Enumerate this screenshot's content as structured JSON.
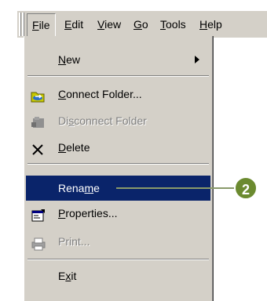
{
  "menubar": {
    "items": [
      {
        "pre": "",
        "key": "F",
        "post": "ile"
      },
      {
        "pre": "",
        "key": "E",
        "post": "dit"
      },
      {
        "pre": "",
        "key": "V",
        "post": "iew"
      },
      {
        "pre": "",
        "key": "G",
        "post": "o"
      },
      {
        "pre": "",
        "key": "T",
        "post": "ools"
      },
      {
        "pre": "",
        "key": "H",
        "post": "elp"
      }
    ]
  },
  "menu": {
    "items": [
      {
        "pre": "",
        "key": "N",
        "post": "ew",
        "icon": "none",
        "submenu": true
      },
      {
        "pre": "",
        "key": "C",
        "post": "onnect Folder...",
        "icon": "connect-folder-icon"
      },
      {
        "pre": "Di",
        "key": "s",
        "post": "connect Folder",
        "icon": "disconnect-folder-icon",
        "disabled": true
      },
      {
        "pre": "",
        "key": "D",
        "post": "elete",
        "icon": "delete-x-icon"
      },
      {
        "pre": "Rena",
        "key": "m",
        "post": "e",
        "icon": "none",
        "highlighted": true
      },
      {
        "pre": "",
        "key": "P",
        "post": "roperties...",
        "icon": "properties-icon"
      },
      {
        "pre": "",
        "key": "",
        "post": "Print...",
        "icon": "print-icon",
        "disabled": true
      },
      {
        "pre": "E",
        "key": "x",
        "post": "it",
        "icon": "none"
      }
    ]
  },
  "callout": {
    "number": "2",
    "color": "#6b8a2f"
  },
  "colors": {
    "menu_bg": "#d4d0c8",
    "highlight": "#0a246a"
  }
}
